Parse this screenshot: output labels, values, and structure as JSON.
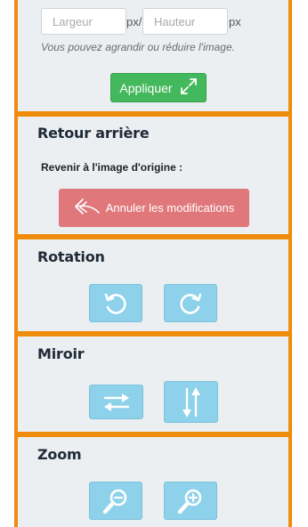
{
  "resize": {
    "width_placeholder": "Largeur",
    "height_placeholder": "Hauteur",
    "unit_sep": "px/",
    "unit": "px",
    "hint": "Vous pouvez agrandir ou réduire l'image.",
    "apply_label": "Appliquer"
  },
  "undo": {
    "title": "Retour arrière",
    "subtitle": "Revenir à l'image d'origine :",
    "button_label": "Annuler les modifications"
  },
  "rotation": {
    "title": "Rotation"
  },
  "mirror": {
    "title": "Miroir"
  },
  "zoom": {
    "title": "Zoom"
  },
  "colors": {
    "frame": "#f08c0c",
    "panel": "#eceff1",
    "apply": "#43b85c",
    "undo": "#e0787b",
    "tool": "#8ed1ea"
  },
  "icons": {
    "apply": "expand-icon",
    "undo": "undo-arrow-icon",
    "rotate_left": "rotate-left-icon",
    "rotate_right": "rotate-right-icon",
    "flip_horizontal": "flip-horizontal-icon",
    "flip_vertical": "flip-vertical-icon",
    "zoom_out": "zoom-out-icon",
    "zoom_in": "zoom-in-icon"
  }
}
